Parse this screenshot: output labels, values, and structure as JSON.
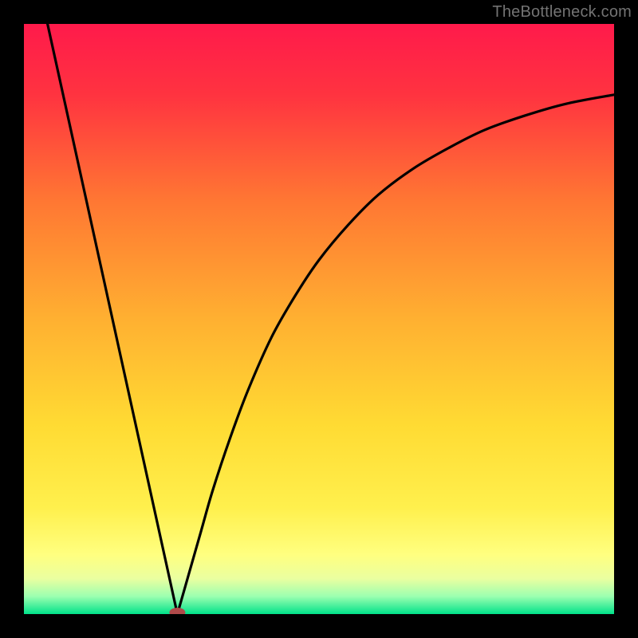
{
  "watermark": "TheBottleneck.com",
  "chart_data": {
    "type": "line",
    "title": "",
    "xlabel": "",
    "ylabel": "",
    "xlim": [
      0,
      100
    ],
    "ylim": [
      0,
      100
    ],
    "grid": false,
    "legend": false,
    "background_gradient": {
      "stops": [
        {
          "offset": 0.0,
          "color": "#ff1a4b"
        },
        {
          "offset": 0.12,
          "color": "#ff3340"
        },
        {
          "offset": 0.3,
          "color": "#ff7733"
        },
        {
          "offset": 0.5,
          "color": "#ffb031"
        },
        {
          "offset": 0.68,
          "color": "#ffdb33"
        },
        {
          "offset": 0.82,
          "color": "#fff04d"
        },
        {
          "offset": 0.9,
          "color": "#ffff80"
        },
        {
          "offset": 0.94,
          "color": "#eaffa0"
        },
        {
          "offset": 0.97,
          "color": "#9cffb0"
        },
        {
          "offset": 1.0,
          "color": "#00e28a"
        }
      ]
    },
    "series": [
      {
        "name": "left-branch",
        "x": [
          4,
          26
        ],
        "y": [
          100,
          0
        ]
      },
      {
        "name": "right-branch",
        "x": [
          26,
          28,
          30,
          32,
          35,
          38,
          42,
          46,
          50,
          55,
          60,
          66,
          72,
          78,
          85,
          92,
          100
        ],
        "y": [
          0,
          7,
          14,
          21,
          30,
          38,
          47,
          54,
          60,
          66,
          71,
          75.5,
          79,
          82,
          84.5,
          86.5,
          88
        ]
      }
    ],
    "marker": {
      "name": "min-marker",
      "x": 26,
      "y": 0,
      "rx": 10,
      "ry": 6,
      "color": "#b04a4a"
    }
  }
}
